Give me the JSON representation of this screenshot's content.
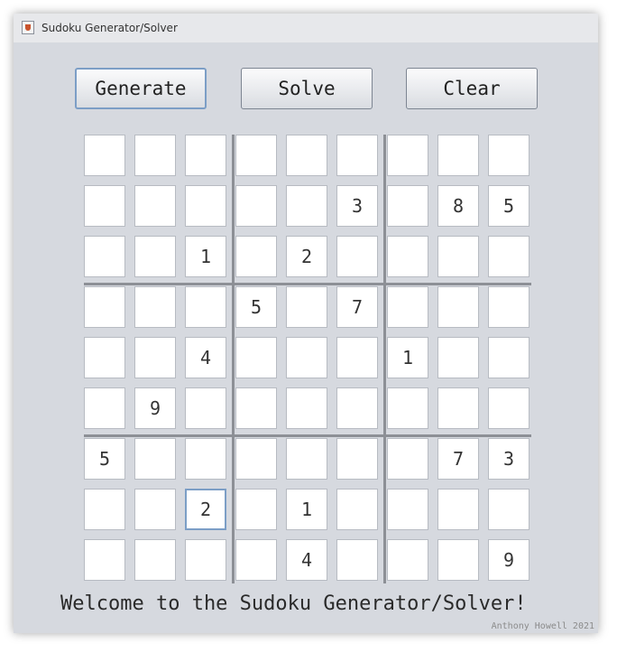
{
  "window": {
    "title": "Sudoku Generator/Solver"
  },
  "toolbar": {
    "generate_label": "Generate",
    "solve_label": "Solve",
    "clear_label": "Clear"
  },
  "board": {
    "rows": [
      [
        "",
        "",
        "",
        "",
        "",
        "",
        "",
        "",
        ""
      ],
      [
        "",
        "",
        "",
        "",
        "",
        "3",
        "",
        "8",
        "5"
      ],
      [
        "",
        "",
        "1",
        "",
        "2",
        "",
        "",
        "",
        ""
      ],
      [
        "",
        "",
        "",
        "5",
        "",
        "7",
        "",
        "",
        ""
      ],
      [
        "",
        "",
        "4",
        "",
        "",
        "",
        "1",
        "",
        ""
      ],
      [
        "",
        "9",
        "",
        "",
        "",
        "",
        "",
        "",
        ""
      ],
      [
        "5",
        "",
        "",
        "",
        "",
        "",
        "",
        "7",
        "3"
      ],
      [
        "",
        "",
        "2",
        "",
        "1",
        "",
        "",
        "",
        ""
      ],
      [
        "",
        "",
        "",
        "",
        "4",
        "",
        "",
        "",
        "9"
      ]
    ]
  },
  "status": {
    "message": "Welcome to the Sudoku Generator/Solver!"
  },
  "footer": {
    "credit": "Anthony Howell 2021"
  }
}
